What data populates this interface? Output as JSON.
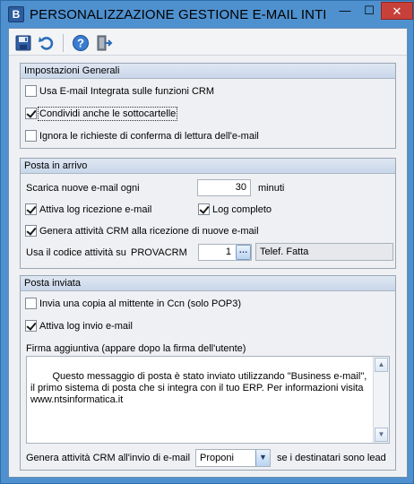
{
  "window": {
    "title": "PERSONALIZZAZIONE GESTIONE E-MAIL INTE...",
    "app_icon_letter": "B",
    "min_glyph": "—",
    "max_glyph": "☐",
    "close_glyph": "✕"
  },
  "toolbar": {
    "items": [
      {
        "icon": "save-icon",
        "label": "Salva"
      },
      {
        "icon": "undo-icon",
        "label": "Ripristina"
      },
      {
        "icon": "help-icon",
        "label": "Aiuto"
      },
      {
        "icon": "exit-icon",
        "label": "Esci"
      }
    ]
  },
  "impostazioni_generali": {
    "title": "Impostazioni Generali",
    "usa_email_integrata": {
      "label": "Usa E-mail Integrata sulle funzioni CRM",
      "checked": false
    },
    "condividi_sottocartelle": {
      "label": "Condividi anche le sottocartelle",
      "checked": true
    },
    "ignora_conferma_lettura": {
      "label": "Ignora le richieste di conferma di lettura dell'e-mail",
      "checked": false
    }
  },
  "posta_in_arrivo": {
    "title": "Posta in arrivo",
    "scarica_label": "Scarica nuove e-mail ogni",
    "scarica_value": "30",
    "scarica_unit": "minuti",
    "attiva_log_ricezione": {
      "label": "Attiva log ricezione e-mail",
      "checked": true
    },
    "log_completo": {
      "label": "Log completo",
      "checked": true
    },
    "genera_attivita_ricezione": {
      "label": "Genera attività CRM alla ricezione di nuove e-mail",
      "checked": true
    },
    "usa_codice_label": "Usa il codice attività su",
    "usa_codice_account": "PROVACRM",
    "codice_value": "1",
    "codice_descrizione": "Telef. Fatta",
    "browse_glyph": "…"
  },
  "posta_inviata": {
    "title": "Posta inviata",
    "invia_copia_mittente": {
      "label": "Invia una copia al mittente in Ccn (solo POP3)",
      "checked": false
    },
    "attiva_log_invio": {
      "label": "Attiva log invio e-mail",
      "checked": true
    },
    "firma_label": "Firma aggiuntiva (appare dopo la firma dell'utente)",
    "firma_text": "Questo messaggio di posta è stato inviato utilizzando \"Business e-mail\", il primo sistema di posta che si integra con il tuo ERP. Per informazioni visita www.ntsinformatica.it",
    "genera_invio_label": "Genera attività CRM all'invio di e-mail",
    "genera_invio_selected": "Proponi",
    "genera_invio_suffix": "se i destinatari sono lead"
  }
}
